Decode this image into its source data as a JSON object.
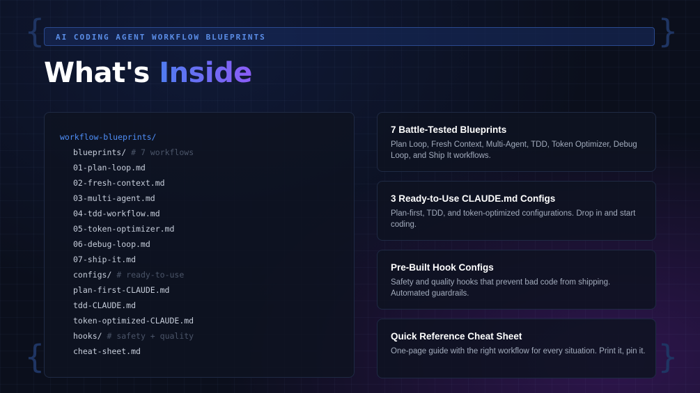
{
  "header": {
    "tag": "AI CODING AGENT WORKFLOW BLUEPRINTS",
    "title_main": "What's",
    "title_accent": "Inside"
  },
  "file_tree": [
    {
      "name": "workflow-blueprints/",
      "comment": "",
      "level": 0
    },
    {
      "name": "blueprints/",
      "comment": "# 7 workflows",
      "level": 1
    },
    {
      "name": "01-plan-loop.md",
      "comment": "",
      "level": 1
    },
    {
      "name": "02-fresh-context.md",
      "comment": "",
      "level": 1
    },
    {
      "name": "03-multi-agent.md",
      "comment": "",
      "level": 1
    },
    {
      "name": "04-tdd-workflow.md",
      "comment": "",
      "level": 1
    },
    {
      "name": "05-token-optimizer.md",
      "comment": "",
      "level": 1
    },
    {
      "name": "06-debug-loop.md",
      "comment": "",
      "level": 1
    },
    {
      "name": "07-ship-it.md",
      "comment": "",
      "level": 1
    },
    {
      "name": "configs/",
      "comment": "# ready-to-use",
      "level": 1
    },
    {
      "name": "plan-first-CLAUDE.md",
      "comment": "",
      "level": 1
    },
    {
      "name": "tdd-CLAUDE.md",
      "comment": "",
      "level": 1
    },
    {
      "name": "token-optimized-CLAUDE.md",
      "comment": "",
      "level": 1
    },
    {
      "name": "hooks/",
      "comment": "# safety + quality",
      "level": 1
    },
    {
      "name": "cheat-sheet.md",
      "comment": "",
      "level": 1
    }
  ],
  "cards": [
    {
      "title": "7 Battle-Tested Blueprints",
      "description": "Plan Loop, Fresh Context, Multi-Agent, TDD, Token Optimizer, Debug Loop, and Ship It workflows."
    },
    {
      "title": "3 Ready-to-Use CLAUDE.md Configs",
      "description": "Plan-first, TDD, and token-optimized configurations. Drop in and start coding."
    },
    {
      "title": "Pre-Built Hook Configs",
      "description": "Safety and quality hooks that prevent bad code from shipping. Automated guardrails."
    },
    {
      "title": "Quick Reference Cheat Sheet",
      "description": "One-page guide with the right workflow for every situation. Print it, pin it."
    }
  ],
  "colors": {
    "accent_blue": "#4f8ef7",
    "accent_purple": "#8b5cf6",
    "background": "#0b0f1c"
  }
}
